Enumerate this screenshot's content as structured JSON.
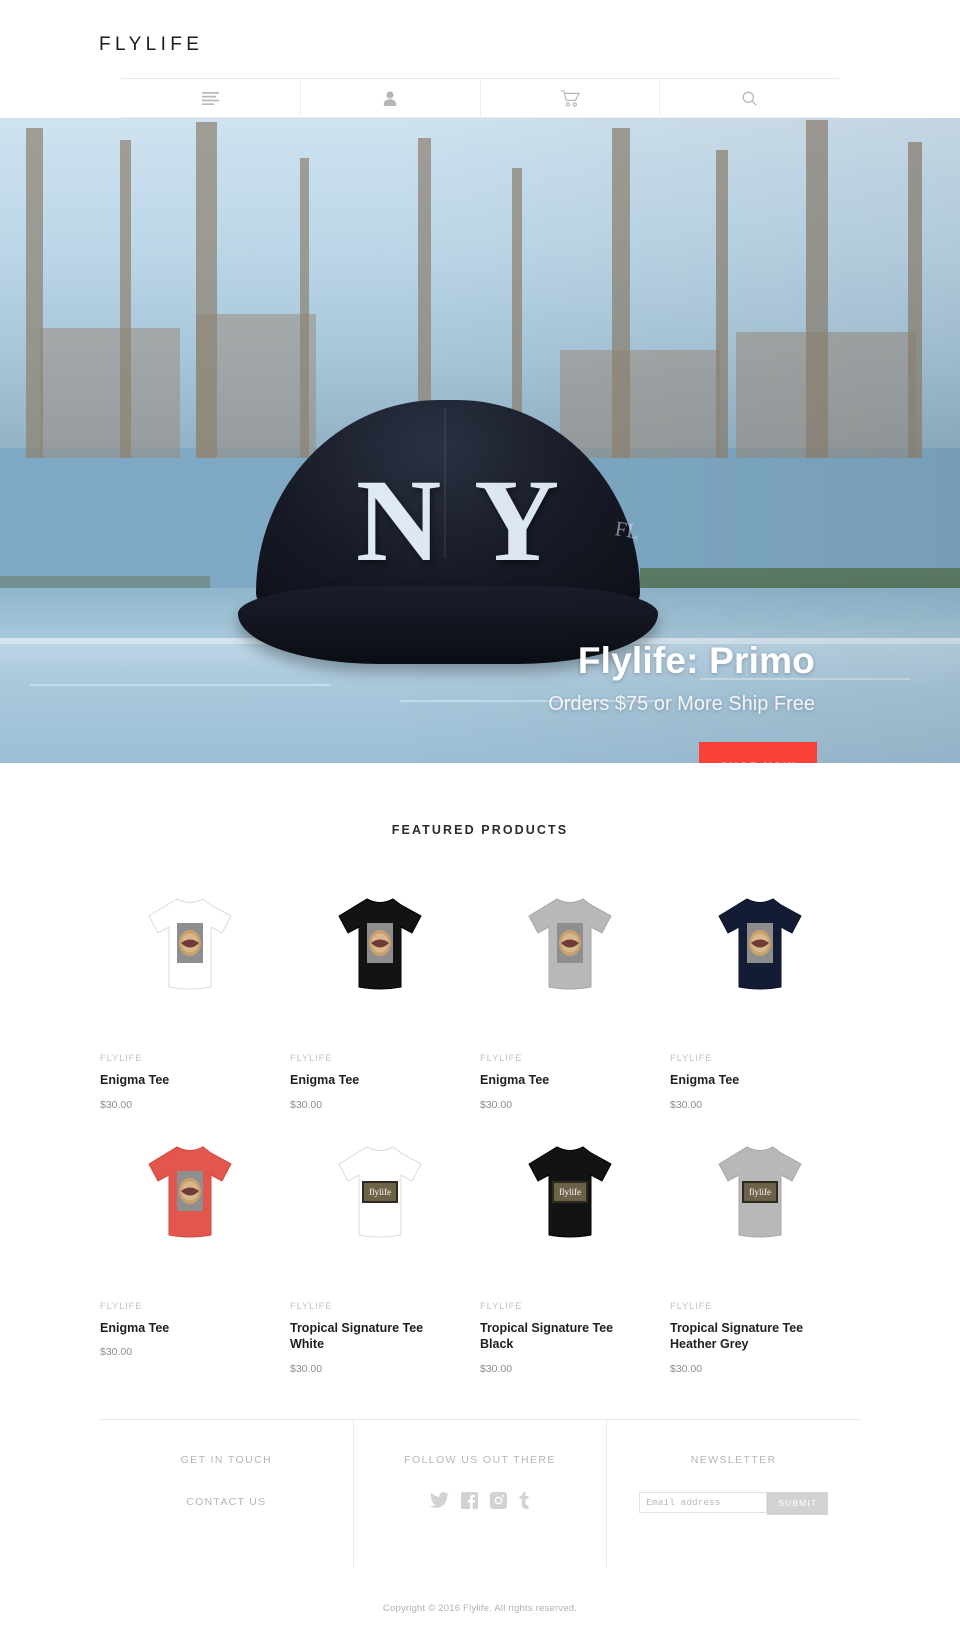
{
  "header": {
    "logo": "FLYLIFE",
    "nav": [
      {
        "name": "menu",
        "icon": "hamburger-menu-icon",
        "label": "Menu"
      },
      {
        "name": "account",
        "icon": "user-account-icon",
        "label": "Account"
      },
      {
        "name": "cart",
        "icon": "shopping-cart-icon",
        "label": "Cart"
      },
      {
        "name": "search",
        "icon": "search-icon",
        "label": "Search"
      }
    ]
  },
  "hero": {
    "title": "Flylife: Primo",
    "subtitle": "Orders $75 or More Ship Free",
    "cta_label": "SHOP NOW",
    "cta_chevron": "›",
    "cta_color": "#f9413a",
    "cap_letters": [
      "N",
      "Y"
    ],
    "cap_side_text": "FL"
  },
  "featured": {
    "heading": "FEATURED PRODUCTS",
    "products": [
      {
        "vendor": "FLYLIFE",
        "title": "Enigma Tee",
        "price": "$30.00",
        "shirt_color": "#ffffff",
        "shirt_stroke": "#dcdcdc",
        "graphic": "lips"
      },
      {
        "vendor": "FLYLIFE",
        "title": "Enigma Tee",
        "price": "$30.00",
        "shirt_color": "#131313",
        "shirt_stroke": "#000000",
        "graphic": "lips"
      },
      {
        "vendor": "FLYLIFE",
        "title": "Enigma Tee",
        "price": "$30.00",
        "shirt_color": "#b8b8b8",
        "shirt_stroke": "#a8a8a8",
        "graphic": "lips"
      },
      {
        "vendor": "FLYLIFE",
        "title": "Enigma Tee",
        "price": "$30.00",
        "shirt_color": "#141c35",
        "shirt_stroke": "#0d1327",
        "graphic": "lips"
      },
      {
        "vendor": "FLYLIFE",
        "title": "Enigma Tee",
        "price": "$30.00",
        "shirt_color": "#e2564e",
        "shirt_stroke": "#d24a42",
        "graphic": "lips"
      },
      {
        "vendor": "FLYLIFE",
        "title": "Tropical Signature Tee White",
        "price": "$30.00",
        "shirt_color": "#ffffff",
        "shirt_stroke": "#dcdcdc",
        "graphic": "box"
      },
      {
        "vendor": "FLYLIFE",
        "title": "Tropical Signature Tee Black",
        "price": "$30.00",
        "shirt_color": "#131313",
        "shirt_stroke": "#000000",
        "graphic": "box"
      },
      {
        "vendor": "FLYLIFE",
        "title": "Tropical Signature Tee Heather Grey",
        "price": "$30.00",
        "shirt_color": "#b8b8b8",
        "shirt_stroke": "#a8a8a8",
        "graphic": "box"
      }
    ]
  },
  "footer": {
    "col_contact": {
      "heading": "GET IN TOUCH",
      "link": "CONTACT US"
    },
    "col_social": {
      "heading": "FOLLOW US OUT THERE",
      "items": [
        {
          "name": "twitter",
          "icon": "twitter-icon"
        },
        {
          "name": "facebook",
          "icon": "facebook-icon"
        },
        {
          "name": "instagram",
          "icon": "instagram-icon"
        },
        {
          "name": "tumblr",
          "icon": "tumblr-icon"
        }
      ]
    },
    "col_newsletter": {
      "heading": "NEWSLETTER",
      "placeholder": "Email address",
      "value": "",
      "submit_label": "SUBMIT"
    },
    "copyright": "Copyright © 2016 Flylife. All rights reserved."
  }
}
